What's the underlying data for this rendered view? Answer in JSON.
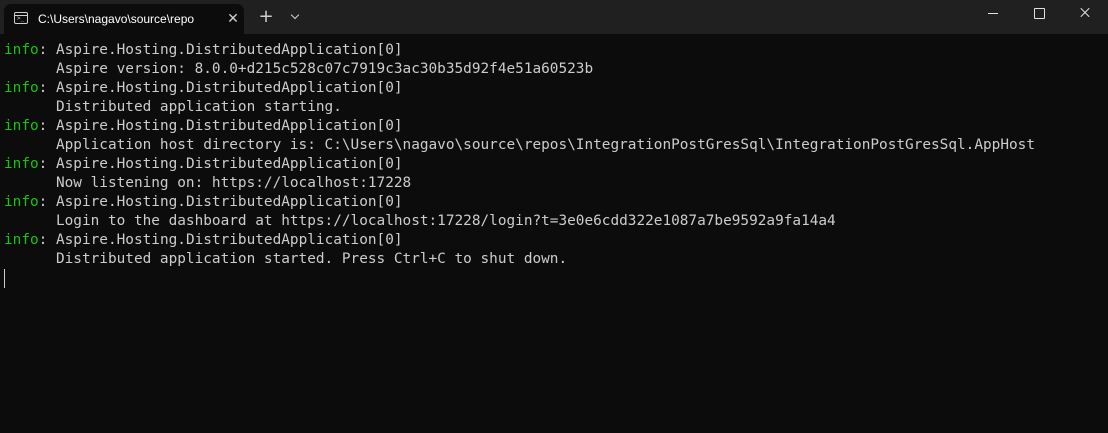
{
  "window": {
    "tab_title": "C:\\Users\\nagavo\\source\\repo",
    "tab_icon": "terminal-icon",
    "close_tab_glyph": "✕",
    "new_tab_glyph": "+",
    "controls": [
      "minimize-icon",
      "maximize-icon",
      "close-icon"
    ]
  },
  "colors": {
    "background": "#0c0c0c",
    "titlebar": "#202020",
    "text": "#cccccc",
    "info": "#16c60c"
  },
  "terminal": {
    "prompt_glyph": ">_",
    "entries": [
      {
        "level": "info",
        "separator": ": ",
        "source": "Aspire.Hosting.DistributedApplication[0]",
        "message": "Aspire version: 8.0.0+d215c528c07c7919c3ac30b35d92f4e51a60523b"
      },
      {
        "level": "info",
        "separator": ": ",
        "source": "Aspire.Hosting.DistributedApplication[0]",
        "message": "Distributed application starting."
      },
      {
        "level": "info",
        "separator": ": ",
        "source": "Aspire.Hosting.DistributedApplication[0]",
        "message": "Application host directory is: C:\\Users\\nagavo\\source\\repos\\IntegrationPostGresSql\\IntegrationPostGresSql.AppHost"
      },
      {
        "level": "info",
        "separator": ": ",
        "source": "Aspire.Hosting.DistributedApplication[0]",
        "message": "Now listening on: https://localhost:17228"
      },
      {
        "level": "info",
        "separator": ": ",
        "source": "Aspire.Hosting.DistributedApplication[0]",
        "message": "Login to the dashboard at https://localhost:17228/login?t=3e0e6cdd322e1087a7be9592a9fa14a4"
      },
      {
        "level": "info",
        "separator": ": ",
        "source": "Aspire.Hosting.DistributedApplication[0]",
        "message": "Distributed application started. Press Ctrl+C to shut down."
      }
    ]
  }
}
